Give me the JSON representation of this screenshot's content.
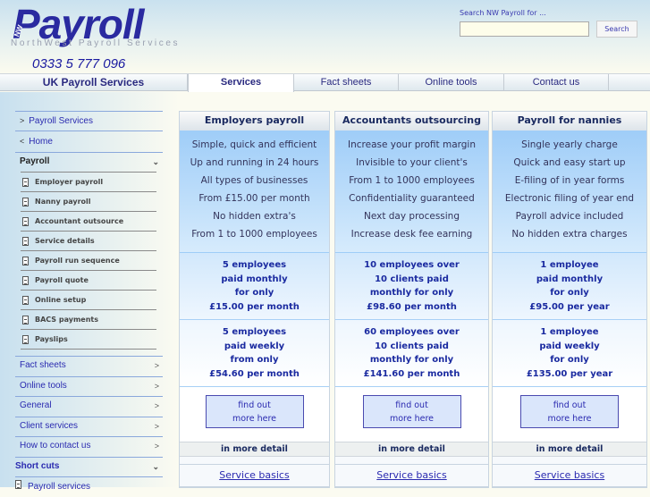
{
  "header": {
    "logo_text": "Payroll",
    "logo_badge": "NW",
    "tagline": "NorthWest Payroll Services",
    "phone": "0333 5 777 096",
    "search_label": "Search NW Payroll for ...",
    "search_value": "",
    "search_button": "Search"
  },
  "nav": {
    "brand": "UK Payroll Services",
    "tabs": [
      {
        "label": "Services",
        "active": true
      },
      {
        "label": "Fact sheets"
      },
      {
        "label": "Online tools"
      },
      {
        "label": "Contact us"
      }
    ]
  },
  "sidebar": {
    "top_links": [
      {
        "label": "Payroll Services",
        "icon": "chevron-right-icon"
      },
      {
        "label": "Home",
        "icon": "chevron-left-icon"
      }
    ],
    "payroll_heading": "Payroll",
    "payroll_items": [
      "Employer payroll",
      "Nanny payroll",
      "Accountant outsource",
      "Service details",
      "Payroll run sequence",
      "Payroll quote",
      "Online setup",
      "BACS payments",
      "Payslips"
    ],
    "sections": [
      "Fact sheets",
      "Online tools",
      "General",
      "Client services",
      "How to contact us"
    ],
    "shortcuts_heading": "Short cuts",
    "shortcut_items": [
      "Payroll services"
    ]
  },
  "columns": [
    {
      "title": "Employers payroll",
      "features": [
        "Simple, quick and efficient",
        "Up and running in 24 hours",
        "All types of businesses",
        "From £15.00 per month",
        "No hidden extra's",
        "From 1 to 1000 employees"
      ],
      "price1": [
        "5 employees",
        "paid monthly",
        "for only",
        "£15.00 per month"
      ],
      "price2": [
        "5 employees",
        "paid weekly",
        "from only",
        "£54.60 per month"
      ],
      "button": [
        "find out",
        "more here"
      ],
      "detail": "in more detail",
      "link": "Service basics"
    },
    {
      "title": "Accountants outsourcing",
      "features": [
        "Increase your profit margin",
        "Invisible to your client's",
        "From 1 to 1000 employees",
        "Confidentiality guaranteed",
        "Next day processing",
        "Increase desk fee earning"
      ],
      "price1": [
        "10 employees over",
        "10 clients paid",
        "monthly for only",
        "£98.60 per month"
      ],
      "price2": [
        "60 employees over",
        "10 clients paid",
        "monthly for only",
        "£141.60 per month"
      ],
      "button": [
        "find out",
        "more here"
      ],
      "detail": "in more detail",
      "link": "Service basics"
    },
    {
      "title": "Payroll for nannies",
      "features": [
        "Single yearly charge",
        "Quick and easy start up",
        "E-filing of in year forms",
        "Electronic filing of year end",
        "Payroll advice included",
        "No hidden extra charges"
      ],
      "price1": [
        "1 employee",
        "paid monthly",
        "for only",
        "£95.00 per year"
      ],
      "price2": [
        "1 employee",
        "paid weekly",
        "for only",
        "£135.00 per year"
      ],
      "button": [
        "find out",
        "more here"
      ],
      "detail": "in more detail",
      "link": "Service basics"
    }
  ]
}
